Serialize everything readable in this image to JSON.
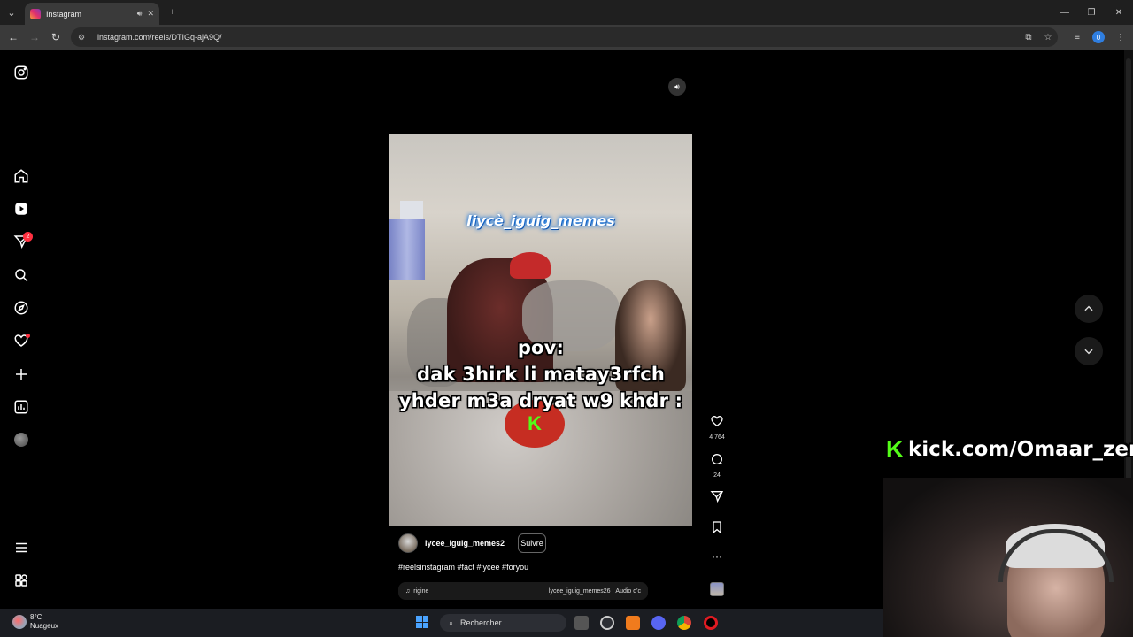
{
  "browser": {
    "tab_title": "Instagram",
    "url": "instagram.com/reels/DTIGq-ajA9Q/",
    "profile_badge": "0"
  },
  "sidebar": {
    "notification_count": "2",
    "icons": [
      "instagram-logo-icon",
      "home-icon",
      "reels-icon",
      "messages-icon",
      "search-icon",
      "explore-icon",
      "notifications-heart-icon",
      "create-plus-icon",
      "dashboard-icon",
      "profile-avatar",
      "more-menu-icon",
      "also-from-meta-icon"
    ]
  },
  "reel": {
    "watermark": "liycè_iguig_memes",
    "caption_line1": "pov:",
    "caption_line2": "dak 3hirk li matay3rfch",
    "caption_line3": "yhder m3a dryat w9 khdr :",
    "overlay_logo": "K",
    "author": "lycee_iguig_memes2",
    "follow_label": "Suivre",
    "hashtags": "#reelsinstagram #fact #lycee #foryou",
    "audio_left": "rigine",
    "audio_right": "lycee_iguig_memes26 · Audio d'c",
    "likes": "4 764",
    "comments": "24"
  },
  "stream_overlay": {
    "kick_k": "K",
    "kick_url": "kick.com/Omaar_zer"
  },
  "taskbar": {
    "temperature": "8°C",
    "weather": "Nuageux",
    "search_placeholder": "Rechercher"
  },
  "colors": {
    "background": "#000000",
    "kick_green": "#53fc18",
    "badge_red": "#ff3040",
    "chrome_dark": "#1f1f1f"
  }
}
